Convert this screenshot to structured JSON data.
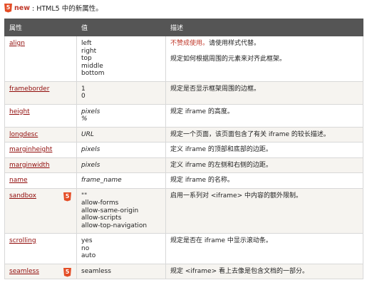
{
  "legend": {
    "badge": "5",
    "new_label": "new",
    "text": ": HTML5 中的新属性。"
  },
  "table": {
    "headers": [
      "属性",
      "值",
      "描述"
    ],
    "rows": [
      {
        "attr": "align",
        "html5": false,
        "values": [
          "left",
          "right",
          "top",
          "middle",
          "bottom"
        ],
        "values_italic": false,
        "desc": [
          {
            "warn": "不赞成使用。",
            "text": "请使用样式代替。"
          },
          {
            "warn": "",
            "text": "规定如何根据周围的元素来对齐此框架。"
          }
        ]
      },
      {
        "attr": "frameborder",
        "html5": false,
        "values": [
          "1",
          "0"
        ],
        "values_italic": false,
        "desc": [
          {
            "warn": "",
            "text": "规定是否显示框架周围的边框。"
          }
        ]
      },
      {
        "attr": "height",
        "html5": false,
        "values": [
          "pixels",
          "%"
        ],
        "values_italic": true,
        "desc": [
          {
            "warn": "",
            "text": "规定 iframe 的高度。"
          }
        ]
      },
      {
        "attr": "longdesc",
        "html5": false,
        "values": [
          "URL"
        ],
        "values_italic": true,
        "desc": [
          {
            "warn": "",
            "text": "规定一个页面，该页面包含了有关 iframe 的较长描述。"
          }
        ]
      },
      {
        "attr": "marginheight",
        "html5": false,
        "values": [
          "pixels"
        ],
        "values_italic": true,
        "desc": [
          {
            "warn": "",
            "text": "定义 iframe 的顶部和底部的边距。"
          }
        ]
      },
      {
        "attr": "marginwidth",
        "html5": false,
        "values": [
          "pixels"
        ],
        "values_italic": true,
        "desc": [
          {
            "warn": "",
            "text": "定义 iframe 的左侧和右侧的边距。"
          }
        ]
      },
      {
        "attr": "name",
        "html5": false,
        "values": [
          "frame_name"
        ],
        "values_italic": true,
        "desc": [
          {
            "warn": "",
            "text": "规定 iframe 的名称。"
          }
        ]
      },
      {
        "attr": "sandbox",
        "html5": true,
        "values": [
          "\"\"",
          "allow-forms",
          "allow-same-origin",
          "allow-scripts",
          "allow-top-navigation"
        ],
        "values_italic": false,
        "desc": [
          {
            "warn": "",
            "text": "启用一系列对 <iframe> 中内容的额外限制。"
          }
        ]
      },
      {
        "attr": "scrolling",
        "html5": false,
        "values": [
          "yes",
          "no",
          "auto"
        ],
        "values_italic": false,
        "desc": [
          {
            "warn": "",
            "text": "规定是否在 iframe 中显示滚动条。"
          }
        ]
      },
      {
        "attr": "seamless",
        "html5": true,
        "values": [
          "seamless"
        ],
        "values_italic": false,
        "desc": [
          {
            "warn": "",
            "text": "规定 <iframe> 看上去像是包含文档的一部分。"
          }
        ]
      }
    ]
  }
}
